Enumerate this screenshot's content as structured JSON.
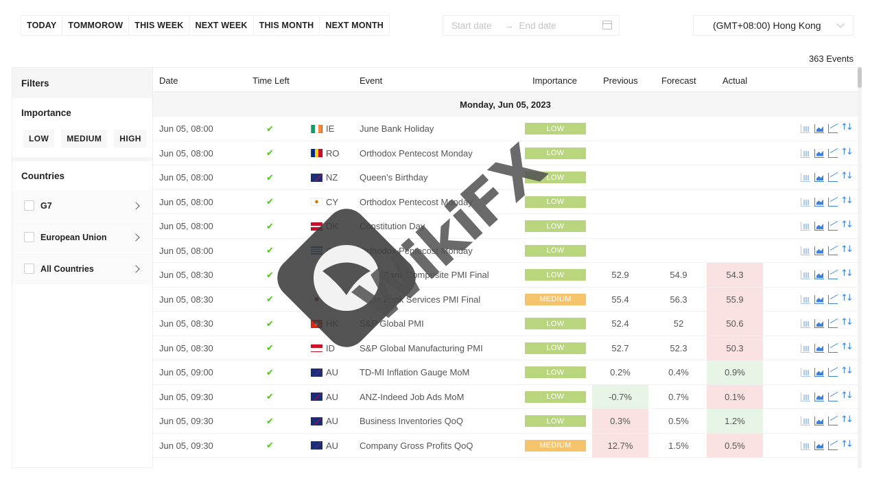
{
  "toolbar": {
    "ranges": [
      "TODAY",
      "TOMMOROW",
      "THIS WEEK",
      "NEXT WEEK",
      "THIS MONTH",
      "NEXT MONTH"
    ],
    "start_placeholder": "Start date",
    "end_placeholder": "End date",
    "timezone": "(GMT+08:00) Hong Kong"
  },
  "events_count": "363 Events",
  "sidebar": {
    "title": "Filters",
    "importance_title": "Importance",
    "importance_options": [
      "LOW",
      "MEDIUM",
      "HIGH"
    ],
    "countries_title": "Countries",
    "country_groups": [
      "G7",
      "European Union",
      "All Countries"
    ]
  },
  "table": {
    "headers": [
      "Date",
      "Time Left",
      "Event",
      "Importance",
      "Previous",
      "Forecast",
      "Actual"
    ],
    "day_label": "Monday, Jun 05, 2023",
    "rows": [
      {
        "date": "Jun 05, 08:00",
        "check": "✔",
        "country": "IE",
        "event": "June Bank Holiday",
        "importance": "LOW",
        "previous": "",
        "forecast": "",
        "actual": "",
        "prev_hl": "",
        "act_hl": ""
      },
      {
        "date": "Jun 05, 08:00",
        "check": "✔",
        "country": "RO",
        "event": "Orthodox Pentecost Monday",
        "importance": "LOW",
        "previous": "",
        "forecast": "",
        "actual": "",
        "prev_hl": "",
        "act_hl": ""
      },
      {
        "date": "Jun 05, 08:00",
        "check": "✔",
        "country": "NZ",
        "event": "Queen’s Birthday",
        "importance": "LOW",
        "previous": "",
        "forecast": "",
        "actual": "",
        "prev_hl": "",
        "act_hl": ""
      },
      {
        "date": "Jun 05, 08:00",
        "check": "✔",
        "country": "CY",
        "event": "Orthodox Pentecost Monday",
        "importance": "LOW",
        "previous": "",
        "forecast": "",
        "actual": "",
        "prev_hl": "",
        "act_hl": ""
      },
      {
        "date": "Jun 05, 08:00",
        "check": "✔",
        "country": "DK",
        "event": "Constitution Day",
        "importance": "LOW",
        "previous": "",
        "forecast": "",
        "actual": "",
        "prev_hl": "",
        "act_hl": ""
      },
      {
        "date": "Jun 05, 08:00",
        "check": "✔",
        "country": "GR",
        "event": "Orthodox Pentecost Monday",
        "importance": "LOW",
        "previous": "",
        "forecast": "",
        "actual": "",
        "prev_hl": "",
        "act_hl": ""
      },
      {
        "date": "Jun 05, 08:30",
        "check": "✔",
        "country": "JP",
        "event": "Jibun Bank Composite PMI Final",
        "importance": "LOW",
        "previous": "52.9",
        "forecast": "54.9",
        "actual": "54.3",
        "prev_hl": "",
        "act_hl": "red"
      },
      {
        "date": "Jun 05, 08:30",
        "check": "✔",
        "country": "JP",
        "event": "Jibun Bank Services PMI Final",
        "importance": "MEDIUM",
        "previous": "55.4",
        "forecast": "56.3",
        "actual": "55.9",
        "prev_hl": "",
        "act_hl": "red"
      },
      {
        "date": "Jun 05, 08:30",
        "check": "✔",
        "country": "HK",
        "event": "S&P Global PMI",
        "importance": "LOW",
        "previous": "52.4",
        "forecast": "52",
        "actual": "50.6",
        "prev_hl": "",
        "act_hl": "red"
      },
      {
        "date": "Jun 05, 08:30",
        "check": "✔",
        "country": "ID",
        "event": "S&P Global Manufacturing PMI",
        "importance": "LOW",
        "previous": "52.7",
        "forecast": "52.3",
        "actual": "50.3",
        "prev_hl": "",
        "act_hl": "red"
      },
      {
        "date": "Jun 05, 09:00",
        "check": "✔",
        "country": "AU",
        "event": "TD-MI Inflation Gauge MoM",
        "importance": "LOW",
        "previous": "0.2%",
        "forecast": "0.4%",
        "actual": "0.9%",
        "prev_hl": "",
        "act_hl": "green"
      },
      {
        "date": "Jun 05, 09:30",
        "check": "✔",
        "country": "AU",
        "event": "ANZ-Indeed Job Ads MoM",
        "importance": "LOW",
        "previous": "-0.7%",
        "forecast": "0.7%",
        "actual": "0.1%",
        "prev_hl": "green",
        "act_hl": "red"
      },
      {
        "date": "Jun 05, 09:30",
        "check": "✔",
        "country": "AU",
        "event": "Business Inventories QoQ",
        "importance": "LOW",
        "previous": "0.3%",
        "forecast": "0.5%",
        "actual": "1.2%",
        "prev_hl": "red",
        "act_hl": "green"
      },
      {
        "date": "Jun 05, 09:30",
        "check": "✔",
        "country": "AU",
        "event": "Company Gross Profits QoQ",
        "importance": "MEDIUM",
        "previous": "12.7%",
        "forecast": "1.5%",
        "actual": "0.5%",
        "prev_hl": "red",
        "act_hl": "red"
      }
    ]
  },
  "colors": {
    "low": "#b9d67f",
    "medium": "#f5c36b",
    "positive": "#e6f5e6",
    "negative": "#fbe2e2",
    "icon_blue": "#3b82d8"
  },
  "watermark": "WikiFX"
}
